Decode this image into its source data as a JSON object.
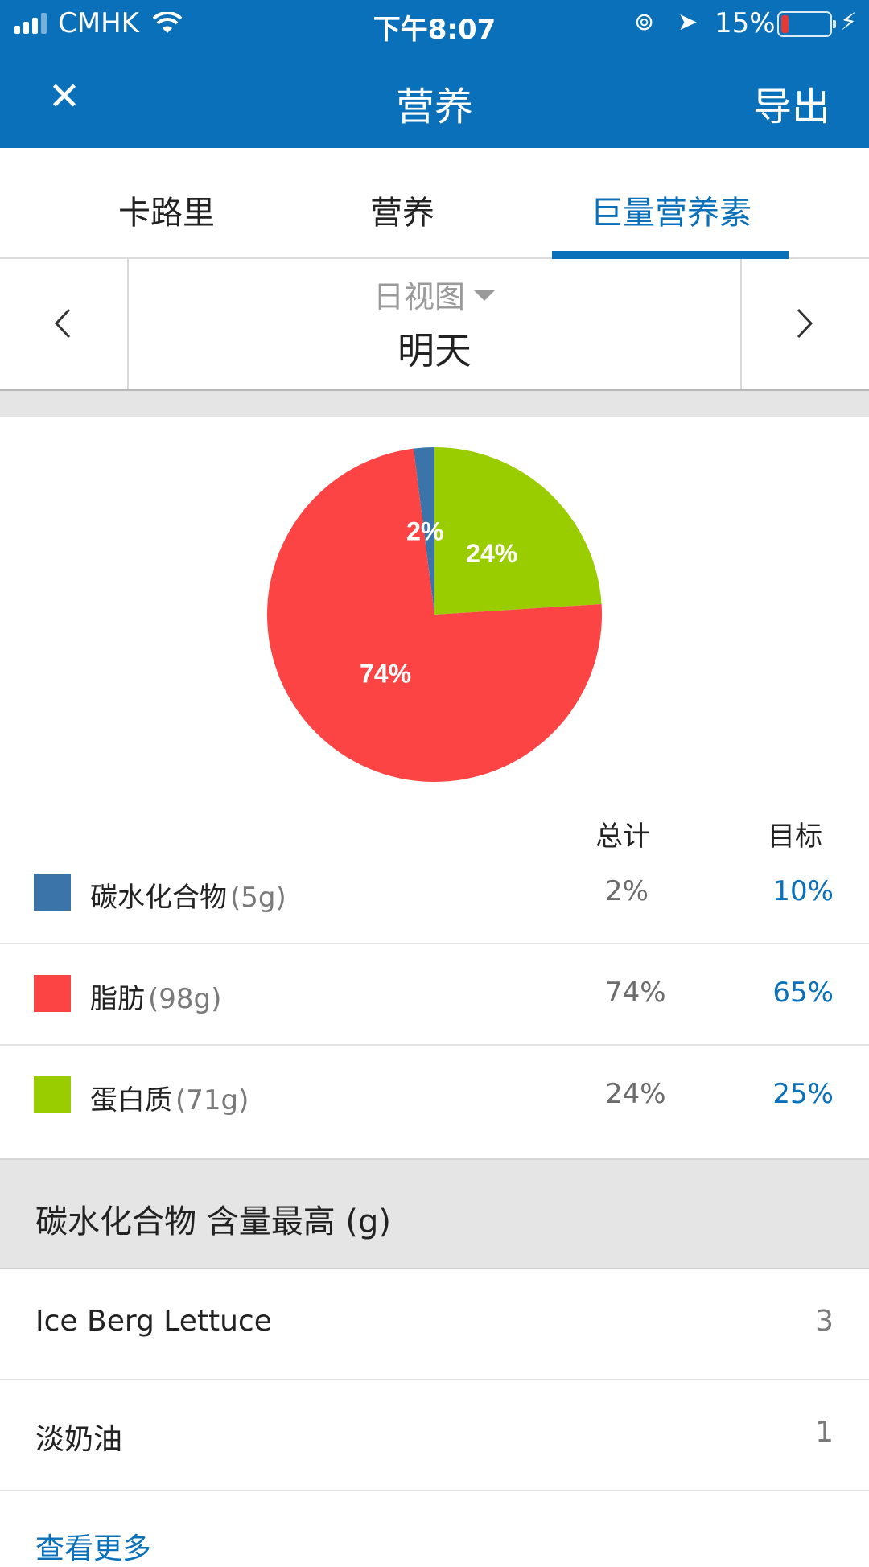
{
  "status_bar": {
    "carrier": "CMHK",
    "time": "下午8:07",
    "battery_percent": "15%",
    "battery_level": 0.15,
    "icons": [
      "signal-icon",
      "wifi-icon",
      "orientation-lock-icon",
      "location-icon",
      "battery-icon",
      "charging-icon"
    ]
  },
  "header": {
    "title": "营养",
    "close_icon": "✕",
    "export_label": "导出",
    "bg_color": "#0a70b9"
  },
  "tabs": [
    {
      "label": "卡路里",
      "active": false
    },
    {
      "label": "营养",
      "active": false
    },
    {
      "label": "巨量营养素",
      "active": true
    }
  ],
  "date_nav": {
    "view_label": "日视图",
    "date_label": "明天"
  },
  "chart_data": {
    "type": "pie",
    "slices": [
      {
        "name": "碳水化合物",
        "value": 2,
        "label": "2%",
        "color": "#3a74a8"
      },
      {
        "name": "蛋白质",
        "value": 24,
        "label": "24%",
        "color": "#9acd00"
      },
      {
        "name": "脂肪",
        "value": 74,
        "label": "74%",
        "color": "#fd4445"
      }
    ]
  },
  "table": {
    "col_total": "总计",
    "col_goal": "目标",
    "rows": [
      {
        "name": "碳水化合物",
        "amount": "(5g)",
        "total": "2%",
        "goal": "10%",
        "color": "#3a74a8"
      },
      {
        "name": "脂肪",
        "amount": "(98g)",
        "total": "74%",
        "goal": "65%",
        "color": "#fd4445"
      },
      {
        "name": "蛋白质",
        "amount": "(71g)",
        "total": "24%",
        "goal": "25%",
        "color": "#9acd00"
      }
    ]
  },
  "top_foods": {
    "title": "碳水化合物 含量最高 (g)",
    "items": [
      {
        "name": "Ice Berg Lettuce",
        "value": "3"
      },
      {
        "name": "淡奶油",
        "value": "1"
      }
    ],
    "more_label": "查看更多"
  },
  "colors": {
    "accent": "#0a70b9",
    "divider": "#e4e4e4",
    "band": "#e5e5e5"
  }
}
